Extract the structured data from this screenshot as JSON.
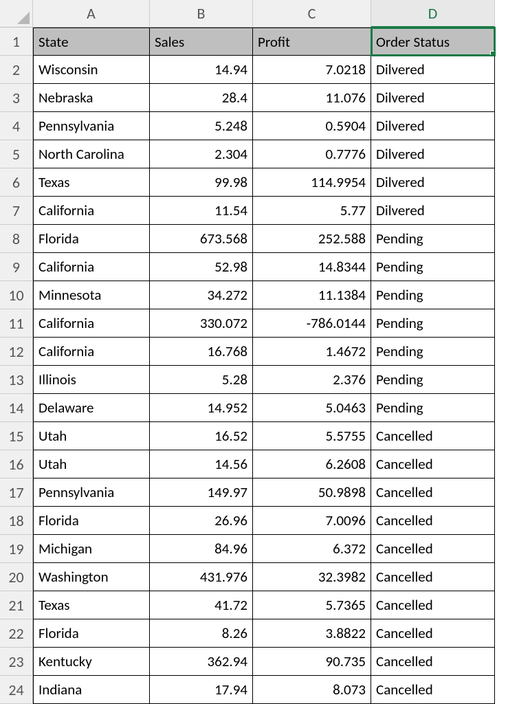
{
  "columns": [
    "A",
    "B",
    "C",
    "D"
  ],
  "active_column_index": 3,
  "selected_cell": {
    "row": 0,
    "col": 3
  },
  "headers": [
    "State",
    "Sales",
    "Profit",
    "Order Status"
  ],
  "rows": [
    {
      "state": "Wisconsin",
      "sales": "14.94",
      "profit": "7.0218",
      "status": "Dilvered"
    },
    {
      "state": "Nebraska",
      "sales": "28.4",
      "profit": "11.076",
      "status": "Dilvered"
    },
    {
      "state": "Pennsylvania",
      "sales": "5.248",
      "profit": "0.5904",
      "status": "Dilvered"
    },
    {
      "state": "North Carolina",
      "sales": "2.304",
      "profit": "0.7776",
      "status": "Dilvered"
    },
    {
      "state": "Texas",
      "sales": "99.98",
      "profit": "114.9954",
      "status": "Dilvered"
    },
    {
      "state": "California",
      "sales": "11.54",
      "profit": "5.77",
      "status": "Dilvered"
    },
    {
      "state": "Florida",
      "sales": "673.568",
      "profit": "252.588",
      "status": "Pending"
    },
    {
      "state": "California",
      "sales": "52.98",
      "profit": "14.8344",
      "status": "Pending"
    },
    {
      "state": "Minnesota",
      "sales": "34.272",
      "profit": "11.1384",
      "status": "Pending"
    },
    {
      "state": "California",
      "sales": "330.072",
      "profit": "-786.0144",
      "status": "Pending"
    },
    {
      "state": "California",
      "sales": "16.768",
      "profit": "1.4672",
      "status": "Pending"
    },
    {
      "state": "Illinois",
      "sales": "5.28",
      "profit": "2.376",
      "status": "Pending"
    },
    {
      "state": "Delaware",
      "sales": "14.952",
      "profit": "5.0463",
      "status": "Pending"
    },
    {
      "state": "Utah",
      "sales": "16.52",
      "profit": "5.5755",
      "status": "Cancelled"
    },
    {
      "state": "Utah",
      "sales": "14.56",
      "profit": "6.2608",
      "status": "Cancelled"
    },
    {
      "state": "Pennsylvania",
      "sales": "149.97",
      "profit": "50.9898",
      "status": "Cancelled"
    },
    {
      "state": "Florida",
      "sales": "26.96",
      "profit": "7.0096",
      "status": "Cancelled"
    },
    {
      "state": "Michigan",
      "sales": "84.96",
      "profit": "6.372",
      "status": "Cancelled"
    },
    {
      "state": "Washington",
      "sales": "431.976",
      "profit": "32.3982",
      "status": "Cancelled"
    },
    {
      "state": "Texas",
      "sales": "41.72",
      "profit": "5.7365",
      "status": "Cancelled"
    },
    {
      "state": "Florida",
      "sales": "8.26",
      "profit": "3.8822",
      "status": "Cancelled"
    },
    {
      "state": "Kentucky",
      "sales": "362.94",
      "profit": "90.735",
      "status": "Cancelled"
    },
    {
      "state": "Indiana",
      "sales": "17.94",
      "profit": "8.073",
      "status": "Cancelled"
    }
  ],
  "chart_data": {
    "type": "table",
    "columns": [
      "State",
      "Sales",
      "Profit",
      "Order Status"
    ],
    "data": [
      [
        "Wisconsin",
        14.94,
        7.0218,
        "Dilvered"
      ],
      [
        "Nebraska",
        28.4,
        11.076,
        "Dilvered"
      ],
      [
        "Pennsylvania",
        5.248,
        0.5904,
        "Dilvered"
      ],
      [
        "North Carolina",
        2.304,
        0.7776,
        "Dilvered"
      ],
      [
        "Texas",
        99.98,
        114.9954,
        "Dilvered"
      ],
      [
        "California",
        11.54,
        5.77,
        "Dilvered"
      ],
      [
        "Florida",
        673.568,
        252.588,
        "Pending"
      ],
      [
        "California",
        52.98,
        14.8344,
        "Pending"
      ],
      [
        "Minnesota",
        34.272,
        11.1384,
        "Pending"
      ],
      [
        "California",
        330.072,
        -786.0144,
        "Pending"
      ],
      [
        "California",
        16.768,
        1.4672,
        "Pending"
      ],
      [
        "Illinois",
        5.28,
        2.376,
        "Pending"
      ],
      [
        "Delaware",
        14.952,
        5.0463,
        "Pending"
      ],
      [
        "Utah",
        16.52,
        5.5755,
        "Cancelled"
      ],
      [
        "Utah",
        14.56,
        6.2608,
        "Cancelled"
      ],
      [
        "Pennsylvania",
        149.97,
        50.9898,
        "Cancelled"
      ],
      [
        "Florida",
        26.96,
        7.0096,
        "Cancelled"
      ],
      [
        "Michigan",
        84.96,
        6.372,
        "Cancelled"
      ],
      [
        "Washington",
        431.976,
        32.3982,
        "Cancelled"
      ],
      [
        "Texas",
        41.72,
        5.7365,
        "Cancelled"
      ],
      [
        "Florida",
        8.26,
        3.8822,
        "Cancelled"
      ],
      [
        "Kentucky",
        362.94,
        90.735,
        "Cancelled"
      ],
      [
        "Indiana",
        17.94,
        8.073,
        "Cancelled"
      ]
    ]
  }
}
